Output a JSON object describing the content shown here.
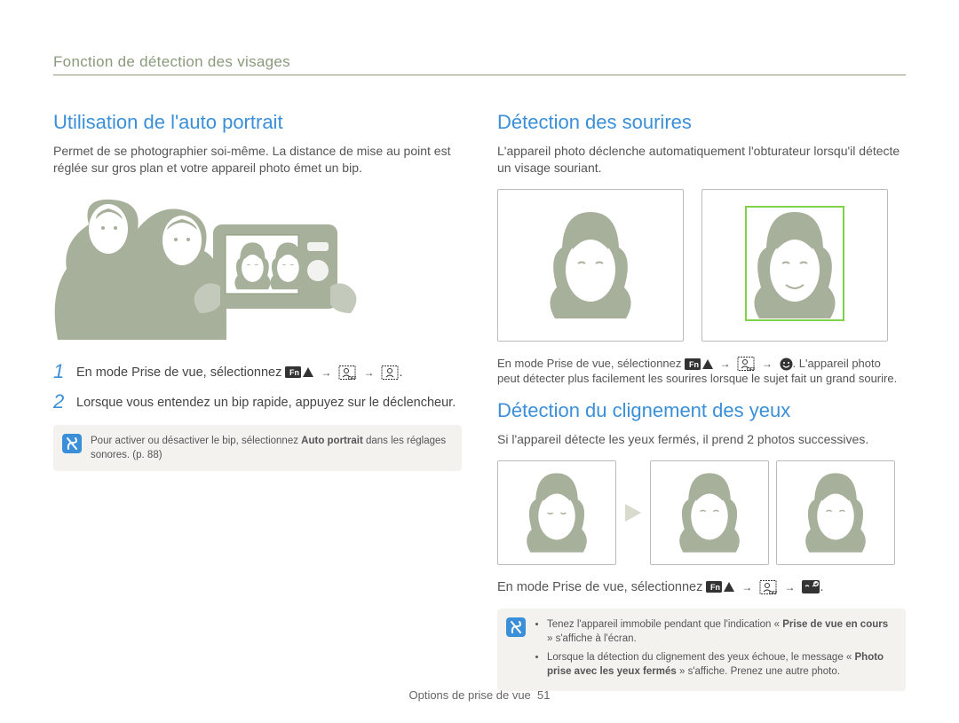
{
  "section_header": "Fonction de détection des visages",
  "left": {
    "title": "Utilisation de l'auto portrait",
    "intro": "Permet de se photographier soi-même. La distance de mise au point est réglée sur gros plan et votre appareil photo émet un bip.",
    "steps": [
      {
        "num": "1",
        "text_pre": "En mode Prise de vue, sélectionnez ",
        "text_post": "."
      },
      {
        "num": "2",
        "text": "Lorsque vous entendez un bip rapide, appuyez sur le déclencheur."
      }
    ],
    "note_pre": "Pour activer ou désactiver le bip, sélectionnez ",
    "note_bold": "Auto portrait",
    "note_post": " dans les réglages sonores. (p. 88)"
  },
  "right": {
    "smile": {
      "title": "Détection des sourires",
      "intro": "L'appareil photo déclenche automatiquement l'obturateur lorsqu'il détecte un visage souriant.",
      "caption_pre": "En mode Prise de vue, sélectionnez ",
      "caption_post": ". L'appareil photo peut détecter plus facilement les sourires lorsque le sujet fait un grand sourire."
    },
    "blink": {
      "title": "Détection du clignement des yeux",
      "intro": "Si l'appareil détecte les yeux fermés, il prend 2 photos successives.",
      "step_pre": "En mode Prise de vue, sélectionnez ",
      "step_post": ".",
      "note_items": [
        {
          "pre": "Tenez l'appareil immobile pendant que l'indication « ",
          "bold": "Prise de vue en cours",
          "post": " » s'affiche à l'écran."
        },
        {
          "pre": "Lorsque la détection du clignement des yeux échoue, le message « ",
          "bold": "Photo prise avec les yeux fermés",
          "post": " » s'affiche. Prenez une autre photo."
        }
      ]
    }
  },
  "footer": {
    "label": "Options de prise de vue",
    "page": "51"
  }
}
